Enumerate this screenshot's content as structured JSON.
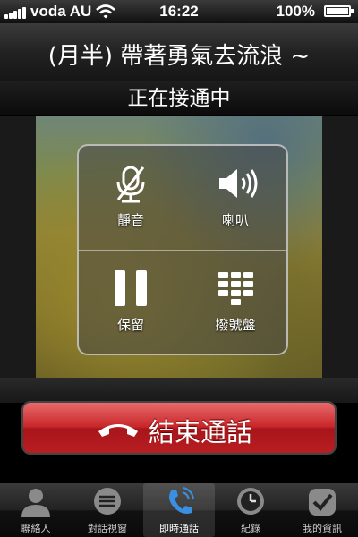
{
  "status_bar": {
    "carrier": "voda AU",
    "time": "16:22",
    "battery": "100%"
  },
  "call": {
    "caller": "(月半)  帶著勇氣去流浪 ~",
    "status": "正在接通中"
  },
  "controls": [
    {
      "label": "靜音",
      "icon": "mute-icon"
    },
    {
      "label": "喇叭",
      "icon": "speaker-icon"
    },
    {
      "label": "保留",
      "icon": "pause-icon"
    },
    {
      "label": "撥號盤",
      "icon": "keypad-icon"
    }
  ],
  "end_call": {
    "label": "結束通話",
    "icon": "phone-hangup-icon"
  },
  "tabs": [
    {
      "label": "聯絡人",
      "icon": "person-icon"
    },
    {
      "label": "對話視窗",
      "icon": "chat-icon"
    },
    {
      "label": "即時通話",
      "icon": "phone-call-icon",
      "active": true
    },
    {
      "label": "紀錄",
      "icon": "clock-icon"
    },
    {
      "label": "我的資訊",
      "icon": "checkmark-badge-icon"
    }
  ],
  "colors": {
    "end_call_red": "#c8262a",
    "active_tab_icon": "#3a8fe0"
  }
}
